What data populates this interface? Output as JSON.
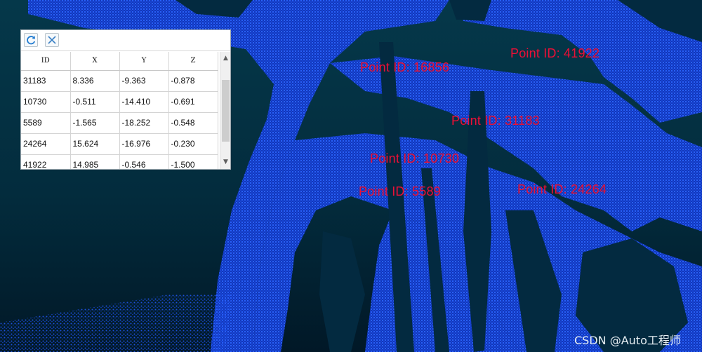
{
  "table": {
    "toolbar": {
      "refresh_icon": "refresh-icon",
      "clear_icon": "close-icon"
    },
    "columns": [
      "ID",
      "X",
      "Y",
      "Z"
    ],
    "rows": [
      [
        "31183",
        "8.336",
        "-9.363",
        "-0.878"
      ],
      [
        "10730",
        "-0.511",
        "-14.410",
        "-0.691"
      ],
      [
        "5589",
        "-1.565",
        "-18.252",
        "-0.548"
      ],
      [
        "24264",
        "15.624",
        "-16.976",
        "-0.230"
      ],
      [
        "41922",
        "14.985",
        "-0.546",
        "-1.500"
      ]
    ]
  },
  "viewport": {
    "labels": [
      {
        "text": "Point ID: 16856"
      },
      {
        "text": "Point ID: 41922"
      },
      {
        "text": "Point ID: 31183"
      },
      {
        "text": "Point ID: 10730"
      },
      {
        "text": "Point ID: 5589"
      },
      {
        "text": "Point ID: 24264"
      }
    ],
    "label_color": "#e8123a",
    "point_color": "#1b4fe6"
  },
  "watermark": "CSDN @Auto工程师"
}
